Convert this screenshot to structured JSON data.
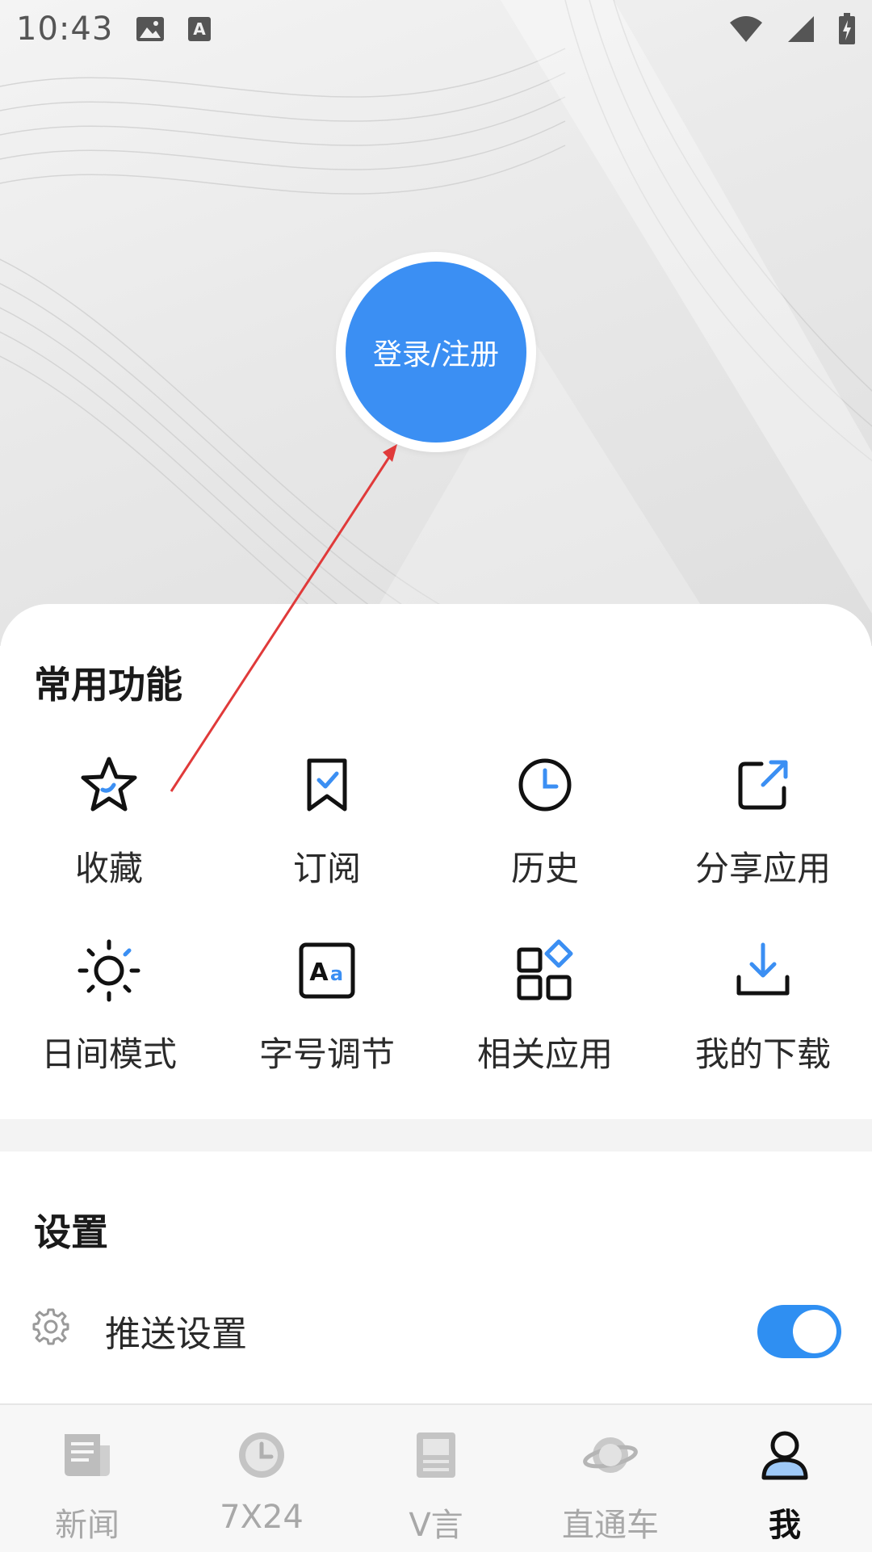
{
  "status_bar": {
    "time": "10:43",
    "icons_left": [
      "image-icon",
      "keyboard-a-icon"
    ],
    "icons_right": [
      "wifi-icon",
      "cell-signal-icon",
      "battery-charging-icon"
    ]
  },
  "login": {
    "label": "登录/注册",
    "color": "#3b8ff3"
  },
  "common_functions": {
    "title": "常用功能",
    "items": [
      {
        "label": "收藏",
        "icon": "star-icon"
      },
      {
        "label": "订阅",
        "icon": "bookmark-check-icon"
      },
      {
        "label": "历史",
        "icon": "clock-icon"
      },
      {
        "label": "分享应用",
        "icon": "share-icon"
      },
      {
        "label": "日间模式",
        "icon": "sun-icon"
      },
      {
        "label": "字号调节",
        "icon": "font-size-icon"
      },
      {
        "label": "相关应用",
        "icon": "apps-icon"
      },
      {
        "label": "我的下载",
        "icon": "download-icon"
      }
    ]
  },
  "settings": {
    "title": "设置",
    "push": {
      "label": "推送设置",
      "icon": "gear-icon",
      "enabled": true
    }
  },
  "bottom_nav": {
    "items": [
      {
        "label": "新闻",
        "icon": "news-icon",
        "active": false
      },
      {
        "label": "7X24",
        "icon": "clock-icon",
        "active": false
      },
      {
        "label": "V言",
        "icon": "article-icon",
        "active": false
      },
      {
        "label": "直通车",
        "icon": "planet-icon",
        "active": false
      },
      {
        "label": "我",
        "icon": "profile-icon",
        "active": true
      }
    ]
  },
  "colors": {
    "accent": "#3b8ff3",
    "annotation": "#e03a3a"
  }
}
